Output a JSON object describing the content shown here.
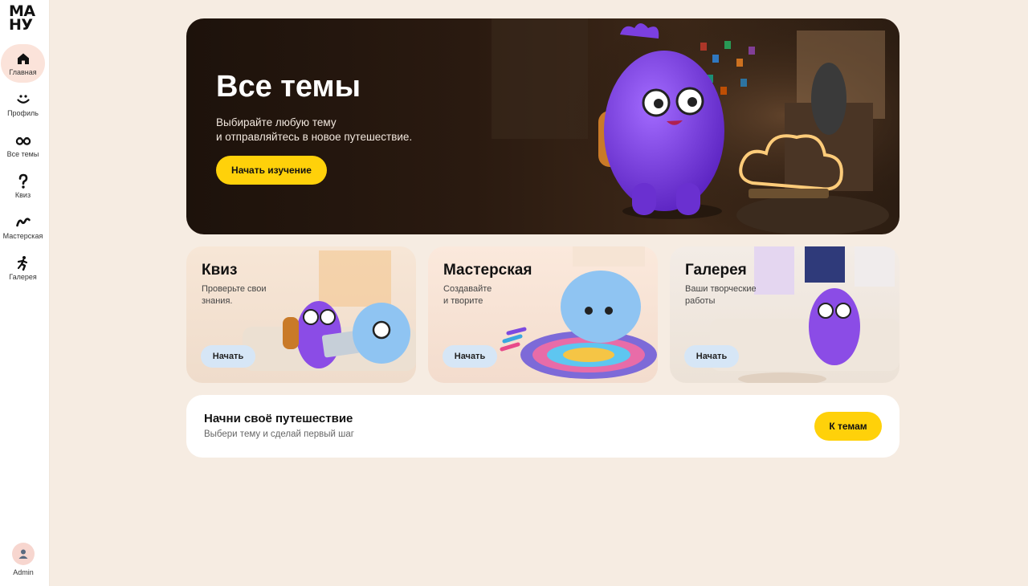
{
  "brand": {
    "logo_line1": "МА",
    "logo_line2": "НУ"
  },
  "sidebar": {
    "items": [
      {
        "label": "Главная",
        "icon": "home-icon",
        "active": true
      },
      {
        "label": "Профиль",
        "icon": "smile-icon"
      },
      {
        "label": "Все темы",
        "icon": "binoculars-icon"
      },
      {
        "label": "Квиз",
        "icon": "question-icon"
      },
      {
        "label": "Мастерская",
        "icon": "squiggle-icon"
      },
      {
        "label": "Галерея",
        "icon": "running-figure-icon"
      }
    ],
    "admin": {
      "label": "Admin",
      "icon": "user-avatar-icon"
    }
  },
  "hero": {
    "title": "Все темы",
    "subtitle_line1": "Выбирайте любую тему",
    "subtitle_line2": "и отправляйтесь в новое путешествие.",
    "button": "Начать изучение"
  },
  "cards": [
    {
      "title": "Квиз",
      "desc_line1": "Проверьте свои",
      "desc_line2": "знания.",
      "button": "Начать"
    },
    {
      "title": "Мастерская",
      "desc_line1": "Создавайте",
      "desc_line2": "и творите",
      "button": "Начать"
    },
    {
      "title": "Галерея",
      "desc_line1": "Ваши творческие",
      "desc_line2": "работы",
      "button": "Начать"
    }
  ],
  "journey": {
    "title": "Начни своё путешествие",
    "subtitle": "Выбери тему и сделай первый шаг",
    "button": "К темам"
  },
  "colors": {
    "background": "#f6ece2",
    "accent_yellow": "#ffd10a",
    "active_nav": "#fbe3da",
    "character_purple": "#7b3fe0",
    "character_blue": "#7cb8ec"
  }
}
